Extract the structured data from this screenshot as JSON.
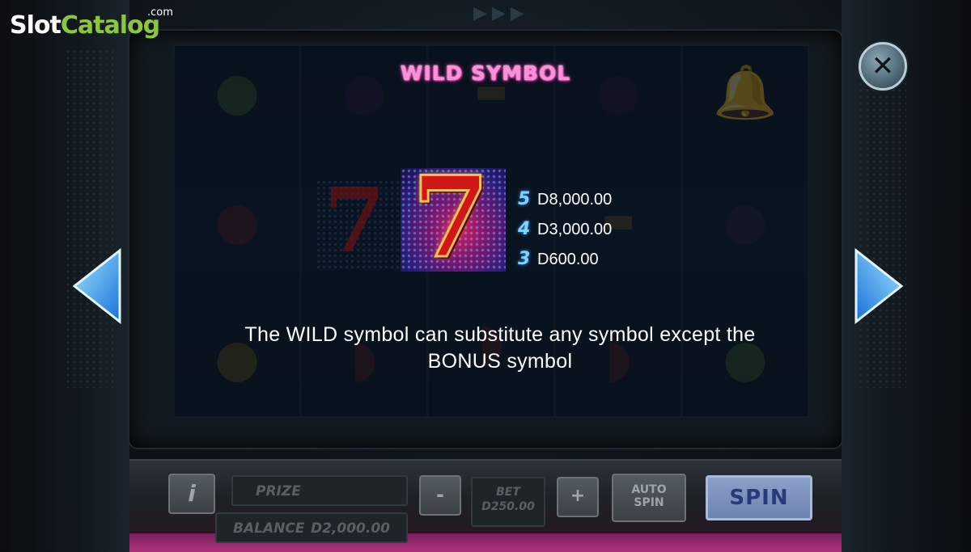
{
  "brand": {
    "logo_part1": "Slot",
    "logo_part2": "Catalog",
    "logo_suffix": ".com",
    "colors": {
      "slot": "#ffffff",
      "catalog": "#8cc63f"
    }
  },
  "page": {
    "title": "WILD SYMBOL",
    "title_color": "#ff8fd8"
  },
  "symbol": {
    "name": "red-seven-wild",
    "glyph": "7"
  },
  "paytable": [
    {
      "count": "5",
      "value": "D8,000.00"
    },
    {
      "count": "4",
      "value": "D3,000.00"
    },
    {
      "count": "3",
      "value": "D600.00"
    }
  ],
  "description": {
    "line1": "The WILD symbol can substitute any symbol except the",
    "line2": "BONUS symbol"
  },
  "controls": {
    "close_label": "✕",
    "prev_icon": "arrow-left-icon",
    "next_icon": "arrow-right-icon"
  },
  "console": {
    "info_label": "i",
    "prize_label": "PRIZE",
    "balance_label": "BALANCE",
    "balance_value": "D2,000.00",
    "minus_label": "-",
    "bet_label": "BET",
    "bet_value": "D250.00",
    "plus_label": "+",
    "auto_spin_line1": "AUTO",
    "auto_spin_line2": "SPIN",
    "spin_label": "SPIN"
  }
}
